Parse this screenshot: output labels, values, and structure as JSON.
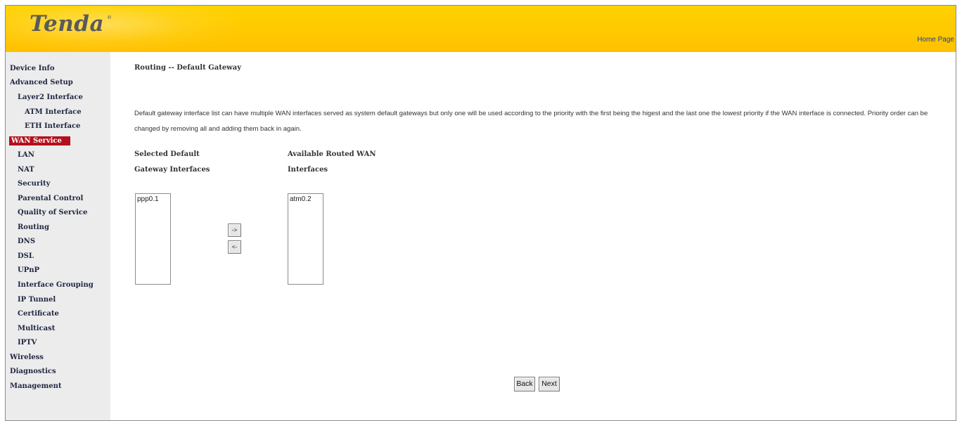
{
  "header": {
    "brand": "Tenda",
    "brand_mark": "®",
    "home_link": "Home Page"
  },
  "sidebar": {
    "items": [
      {
        "label": "Device Info",
        "level": 0
      },
      {
        "label": "Advanced Setup",
        "level": 0
      },
      {
        "label": "Layer2 Interface",
        "level": 1
      },
      {
        "label": "ATM Interface",
        "level": 2
      },
      {
        "label": "ETH Interface",
        "level": 2
      },
      {
        "label": "WAN Service",
        "level": 1,
        "selected": true
      },
      {
        "label": "LAN",
        "level": 1
      },
      {
        "label": "NAT",
        "level": 1
      },
      {
        "label": "Security",
        "level": 1
      },
      {
        "label": "Parental Control",
        "level": 1
      },
      {
        "label": "Quality of Service",
        "level": 1
      },
      {
        "label": "Routing",
        "level": 1
      },
      {
        "label": "DNS",
        "level": 1
      },
      {
        "label": "DSL",
        "level": 1
      },
      {
        "label": "UPnP",
        "level": 1
      },
      {
        "label": "Interface Grouping",
        "level": 1
      },
      {
        "label": "IP Tunnel",
        "level": 1
      },
      {
        "label": "Certificate",
        "level": 1
      },
      {
        "label": "Multicast",
        "level": 1
      },
      {
        "label": "IPTV",
        "level": 1
      },
      {
        "label": "Wireless",
        "level": 0
      },
      {
        "label": "Diagnostics",
        "level": 0
      },
      {
        "label": "Management",
        "level": 0
      }
    ]
  },
  "main": {
    "title": "Routing -- Default Gateway",
    "description": "Default gateway interface list can have multiple WAN interfaces served as system default gateways but only one will be used according to the priority with the first being the higest and the last one the lowest priority if the WAN interface is connected. Priority order can be changed by removing all and adding them back in again.",
    "selected_label_line1": "Selected Default",
    "selected_label_line2": "Gateway Interfaces",
    "available_label_line1": "Available Routed WAN",
    "available_label_line2": "Interfaces",
    "selected_options": [
      "ppp0.1"
    ],
    "available_options": [
      "atm0.2"
    ],
    "move_right_label": "->",
    "move_left_label": "<-",
    "back_label": "Back",
    "next_label": "Next"
  },
  "colors": {
    "header_yellow": "#ffc800",
    "sidebar_bg": "#ececec",
    "selected_nav_bg": "#b3101c",
    "nav_text": "#1f2640"
  }
}
